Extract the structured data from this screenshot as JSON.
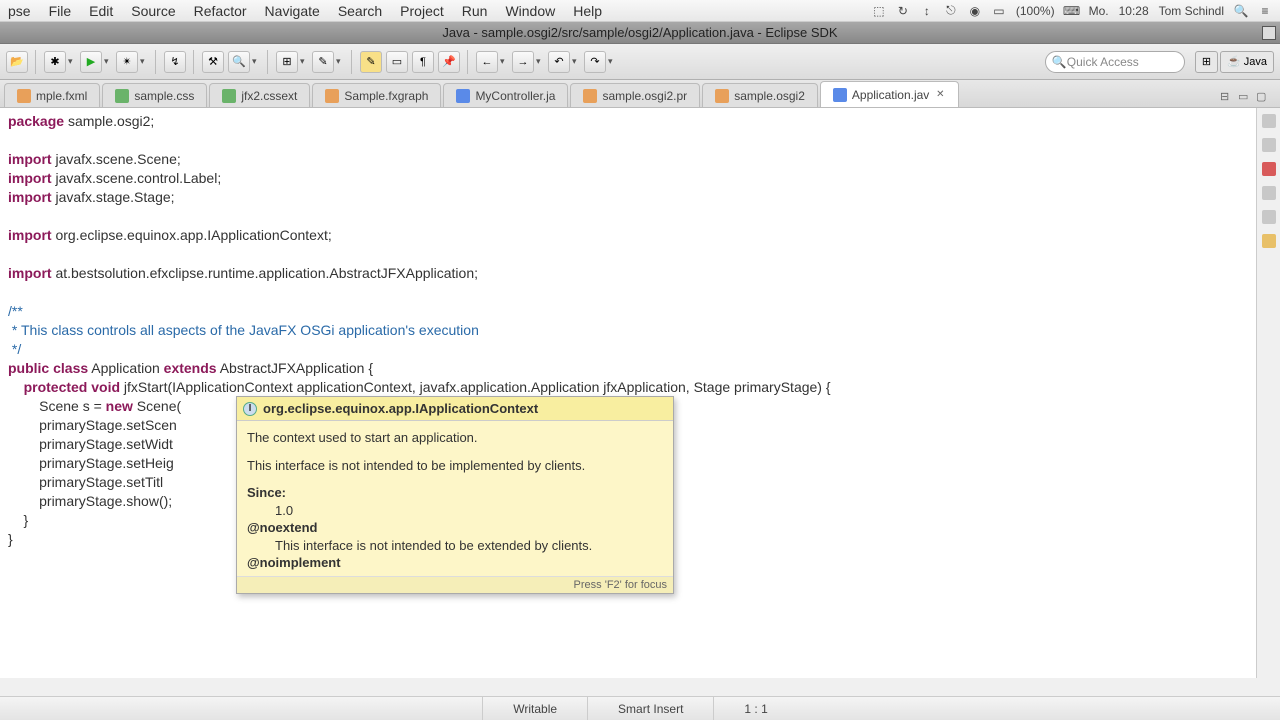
{
  "menubar": {
    "items": [
      "pse",
      "File",
      "Edit",
      "Source",
      "Refactor",
      "Navigate",
      "Search",
      "Project",
      "Run",
      "Window",
      "Help"
    ],
    "battery": "(100%)",
    "day": "Mo.",
    "time": "10:28",
    "user": "Tom Schindl"
  },
  "titlebar": {
    "text": "Java - sample.osgi2/src/sample/osgi2/Application.java - Eclipse SDK"
  },
  "quick_access": {
    "placeholder": "Quick Access"
  },
  "perspectives": {
    "java": "Java"
  },
  "tabs": [
    {
      "label": "mple.fxml",
      "icon": "xml"
    },
    {
      "label": "sample.css",
      "icon": "css"
    },
    {
      "label": "jfx2.cssext",
      "icon": "css"
    },
    {
      "label": "Sample.fxgraph",
      "icon": "xml"
    },
    {
      "label": "MyController.ja",
      "icon": "java"
    },
    {
      "label": "sample.osgi2.pr",
      "icon": "xml"
    },
    {
      "label": "sample.osgi2",
      "icon": "xml"
    },
    {
      "label": "Application.jav",
      "icon": "java",
      "active": true
    }
  ],
  "code": {
    "l0": "package sample.osgi2;",
    "l1": "",
    "l2": "import javafx.scene.Scene;",
    "l3": "import javafx.scene.control.Label;",
    "l4": "import javafx.stage.Stage;",
    "l5": "",
    "l6": "import org.eclipse.equinox.app.IApplicationContext;",
    "l7": "",
    "l8": "import at.bestsolution.efxclipse.runtime.application.AbstractJFXApplication;",
    "l9": "",
    "l10": "/**",
    "l11": " * This class controls all aspects of the JavaFX OSGi application's execution",
    "l12": " */",
    "l13": "public class Application extends AbstractJFXApplication {",
    "l14": "    protected void jfxStart(IApplicationContext applicationContext, javafx.application.Application jfxApplication, Stage primaryStage) {",
    "l15": "        Scene s = new Scene(",
    "l16": "        primaryStage.setScen",
    "l17": "        primaryStage.setWidt",
    "l18": "        primaryStage.setHeig",
    "l19": "        primaryStage.setTitl",
    "l20": "        primaryStage.show();",
    "l21": "    }",
    "l22": "}"
  },
  "hover": {
    "title": "org.eclipse.equinox.app.IApplicationContext",
    "p1": "The context used to start an application.",
    "p2": "This interface is not intended to be implemented by clients.",
    "since_label": "Since:",
    "since_val": "1.0",
    "tag1": "@noextend",
    "tag1_desc": "This interface is not intended to be extended by clients.",
    "tag2": "@noimplement",
    "footer": "Press 'F2' for focus"
  },
  "status": {
    "writable": "Writable",
    "insert": "Smart Insert",
    "pos": "1 : 1"
  }
}
